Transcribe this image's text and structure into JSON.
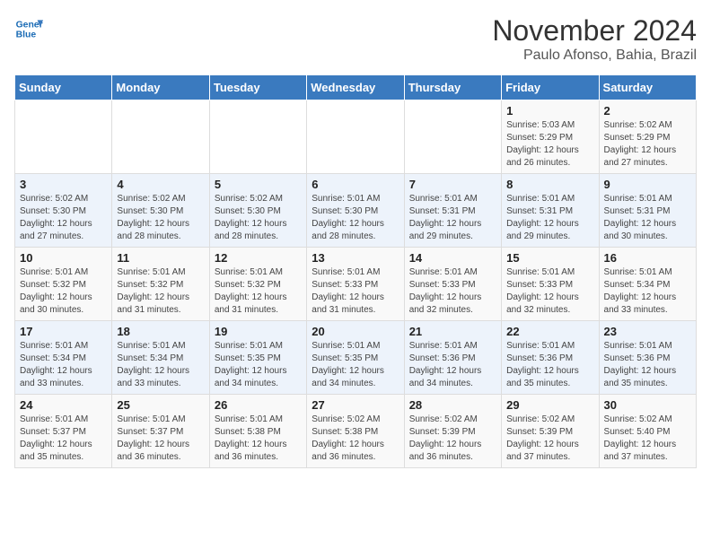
{
  "logo": {
    "line1": "General",
    "line2": "Blue"
  },
  "title": "November 2024",
  "subtitle": "Paulo Afonso, Bahia, Brazil",
  "days_of_week": [
    "Sunday",
    "Monday",
    "Tuesday",
    "Wednesday",
    "Thursday",
    "Friday",
    "Saturday"
  ],
  "weeks": [
    [
      {
        "day": "",
        "info": ""
      },
      {
        "day": "",
        "info": ""
      },
      {
        "day": "",
        "info": ""
      },
      {
        "day": "",
        "info": ""
      },
      {
        "day": "",
        "info": ""
      },
      {
        "day": "1",
        "info": "Sunrise: 5:03 AM\nSunset: 5:29 PM\nDaylight: 12 hours\nand 26 minutes."
      },
      {
        "day": "2",
        "info": "Sunrise: 5:02 AM\nSunset: 5:29 PM\nDaylight: 12 hours\nand 27 minutes."
      }
    ],
    [
      {
        "day": "3",
        "info": "Sunrise: 5:02 AM\nSunset: 5:30 PM\nDaylight: 12 hours\nand 27 minutes."
      },
      {
        "day": "4",
        "info": "Sunrise: 5:02 AM\nSunset: 5:30 PM\nDaylight: 12 hours\nand 28 minutes."
      },
      {
        "day": "5",
        "info": "Sunrise: 5:02 AM\nSunset: 5:30 PM\nDaylight: 12 hours\nand 28 minutes."
      },
      {
        "day": "6",
        "info": "Sunrise: 5:01 AM\nSunset: 5:30 PM\nDaylight: 12 hours\nand 28 minutes."
      },
      {
        "day": "7",
        "info": "Sunrise: 5:01 AM\nSunset: 5:31 PM\nDaylight: 12 hours\nand 29 minutes."
      },
      {
        "day": "8",
        "info": "Sunrise: 5:01 AM\nSunset: 5:31 PM\nDaylight: 12 hours\nand 29 minutes."
      },
      {
        "day": "9",
        "info": "Sunrise: 5:01 AM\nSunset: 5:31 PM\nDaylight: 12 hours\nand 30 minutes."
      }
    ],
    [
      {
        "day": "10",
        "info": "Sunrise: 5:01 AM\nSunset: 5:32 PM\nDaylight: 12 hours\nand 30 minutes."
      },
      {
        "day": "11",
        "info": "Sunrise: 5:01 AM\nSunset: 5:32 PM\nDaylight: 12 hours\nand 31 minutes."
      },
      {
        "day": "12",
        "info": "Sunrise: 5:01 AM\nSunset: 5:32 PM\nDaylight: 12 hours\nand 31 minutes."
      },
      {
        "day": "13",
        "info": "Sunrise: 5:01 AM\nSunset: 5:33 PM\nDaylight: 12 hours\nand 31 minutes."
      },
      {
        "day": "14",
        "info": "Sunrise: 5:01 AM\nSunset: 5:33 PM\nDaylight: 12 hours\nand 32 minutes."
      },
      {
        "day": "15",
        "info": "Sunrise: 5:01 AM\nSunset: 5:33 PM\nDaylight: 12 hours\nand 32 minutes."
      },
      {
        "day": "16",
        "info": "Sunrise: 5:01 AM\nSunset: 5:34 PM\nDaylight: 12 hours\nand 33 minutes."
      }
    ],
    [
      {
        "day": "17",
        "info": "Sunrise: 5:01 AM\nSunset: 5:34 PM\nDaylight: 12 hours\nand 33 minutes."
      },
      {
        "day": "18",
        "info": "Sunrise: 5:01 AM\nSunset: 5:34 PM\nDaylight: 12 hours\nand 33 minutes."
      },
      {
        "day": "19",
        "info": "Sunrise: 5:01 AM\nSunset: 5:35 PM\nDaylight: 12 hours\nand 34 minutes."
      },
      {
        "day": "20",
        "info": "Sunrise: 5:01 AM\nSunset: 5:35 PM\nDaylight: 12 hours\nand 34 minutes."
      },
      {
        "day": "21",
        "info": "Sunrise: 5:01 AM\nSunset: 5:36 PM\nDaylight: 12 hours\nand 34 minutes."
      },
      {
        "day": "22",
        "info": "Sunrise: 5:01 AM\nSunset: 5:36 PM\nDaylight: 12 hours\nand 35 minutes."
      },
      {
        "day": "23",
        "info": "Sunrise: 5:01 AM\nSunset: 5:36 PM\nDaylight: 12 hours\nand 35 minutes."
      }
    ],
    [
      {
        "day": "24",
        "info": "Sunrise: 5:01 AM\nSunset: 5:37 PM\nDaylight: 12 hours\nand 35 minutes."
      },
      {
        "day": "25",
        "info": "Sunrise: 5:01 AM\nSunset: 5:37 PM\nDaylight: 12 hours\nand 36 minutes."
      },
      {
        "day": "26",
        "info": "Sunrise: 5:01 AM\nSunset: 5:38 PM\nDaylight: 12 hours\nand 36 minutes."
      },
      {
        "day": "27",
        "info": "Sunrise: 5:02 AM\nSunset: 5:38 PM\nDaylight: 12 hours\nand 36 minutes."
      },
      {
        "day": "28",
        "info": "Sunrise: 5:02 AM\nSunset: 5:39 PM\nDaylight: 12 hours\nand 36 minutes."
      },
      {
        "day": "29",
        "info": "Sunrise: 5:02 AM\nSunset: 5:39 PM\nDaylight: 12 hours\nand 37 minutes."
      },
      {
        "day": "30",
        "info": "Sunrise: 5:02 AM\nSunset: 5:40 PM\nDaylight: 12 hours\nand 37 minutes."
      }
    ]
  ]
}
